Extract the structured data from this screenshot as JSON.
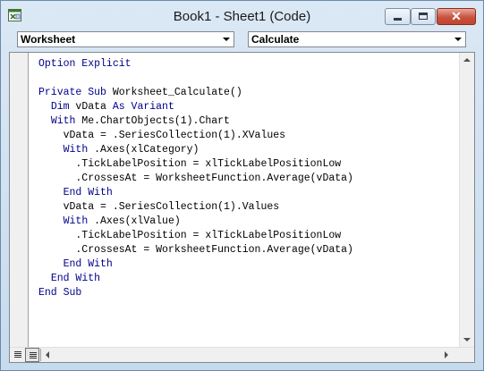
{
  "window": {
    "title": "Book1 - Sheet1 (Code)",
    "close_symbol": "✕"
  },
  "object_combo": {
    "value": "Worksheet"
  },
  "procedure_combo": {
    "value": "Calculate"
  },
  "code_lines": [
    [
      {
        "k": 1,
        "t": "Option Explicit"
      }
    ],
    [],
    [
      {
        "k": 1,
        "t": "Private Sub "
      },
      {
        "k": 0,
        "t": "Worksheet_Calculate()"
      }
    ],
    [
      {
        "k": 0,
        "t": "  "
      },
      {
        "k": 1,
        "t": "Dim "
      },
      {
        "k": 0,
        "t": "vData "
      },
      {
        "k": 1,
        "t": "As Variant"
      }
    ],
    [
      {
        "k": 0,
        "t": "  "
      },
      {
        "k": 1,
        "t": "With "
      },
      {
        "k": 0,
        "t": "Me.ChartObjects(1).Chart"
      }
    ],
    [
      {
        "k": 0,
        "t": "    vData = .SeriesCollection(1).XValues"
      }
    ],
    [
      {
        "k": 0,
        "t": "    "
      },
      {
        "k": 1,
        "t": "With "
      },
      {
        "k": 0,
        "t": ".Axes(xlCategory)"
      }
    ],
    [
      {
        "k": 0,
        "t": "      .TickLabelPosition = xlTickLabelPositionLow"
      }
    ],
    [
      {
        "k": 0,
        "t": "      .CrossesAt = WorksheetFunction.Average(vData)"
      }
    ],
    [
      {
        "k": 0,
        "t": "    "
      },
      {
        "k": 1,
        "t": "End With"
      }
    ],
    [
      {
        "k": 0,
        "t": "    vData = .SeriesCollection(1).Values"
      }
    ],
    [
      {
        "k": 0,
        "t": "    "
      },
      {
        "k": 1,
        "t": "With "
      },
      {
        "k": 0,
        "t": ".Axes(xlValue)"
      }
    ],
    [
      {
        "k": 0,
        "t": "      .TickLabelPosition = xlTickLabelPositionLow"
      }
    ],
    [
      {
        "k": 0,
        "t": "      .CrossesAt = WorksheetFunction.Average(vData)"
      }
    ],
    [
      {
        "k": 0,
        "t": "    "
      },
      {
        "k": 1,
        "t": "End With"
      }
    ],
    [
      {
        "k": 0,
        "t": "  "
      },
      {
        "k": 1,
        "t": "End With"
      }
    ],
    [
      {
        "k": 1,
        "t": "End Sub"
      }
    ]
  ],
  "colors": {
    "keyword": "#00008b",
    "text": "#000000"
  }
}
